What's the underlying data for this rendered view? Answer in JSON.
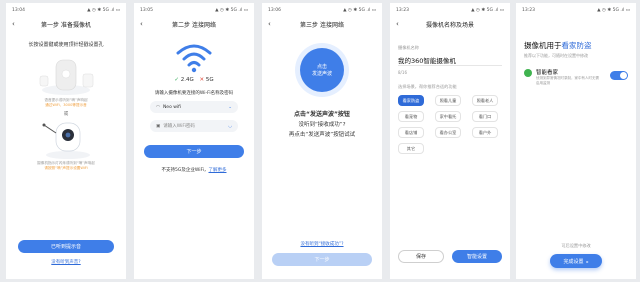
{
  "screens": [
    {
      "status": {
        "time": "13:04",
        "icons": "▲ ◷ ✱ 5G .ıl ▭"
      },
      "title": "第一步 准备摄像机",
      "instruction": "长按设置键或使用顶针轻戳设置孔",
      "device1_caption_line1": "语音提示或听到“嘀”声响起",
      "device1_caption_line2": "通过WiFi、3000等提示音",
      "or_label": "或",
      "device2_caption_line1": "摄像机指示灯闪烁或听到“嘀”声响起",
      "device2_caption_line2": "请按照“嘀”声提示设置WiFi",
      "primary_button": "已听到提示音",
      "link": "没有听到声音?"
    },
    {
      "status": {
        "time": "13:05",
        "icons": "▲ ◷ ✱ 5G .ıl ▭"
      },
      "title": "第二步 连接网络",
      "band_24": "2.4G",
      "band_5": "5G",
      "instruction": "请输入摄像机要连接的Wi-Fi名称及密码",
      "wifi_name": "Neo wifi",
      "password_placeholder": "请输入WiFi密码",
      "next_button": "下一步",
      "bottom_note": "不支持5G及企业WiFi，",
      "bottom_link": "了解更多"
    },
    {
      "status": {
        "time": "13:06",
        "icons": "▲ ◷ ✱ 5G .ıl ▭"
      },
      "title": "第三步 连接网络",
      "circle_line1": "点击",
      "circle_line2": "发送声波",
      "main_text": "点击“发送声波”按钮",
      "line2": "没听到“接收成功”?",
      "line3": "再点击“发送声波”按钮试试",
      "link": "没有听到“接收成功”?",
      "next_button": "下一步"
    },
    {
      "status": {
        "time": "13:23",
        "icons": "▲ ◷ ✱ 5G .ıl ▭"
      },
      "title": "摄像机名称及场景",
      "name_label": "摄像机名称",
      "name_value": "我的360智能摄像机",
      "name_counter": "8/16",
      "scene_label": "选择场景，帮你推荐合适的功能",
      "chips": [
        "看家防盗",
        "照看儿童",
        "照看老人",
        "看宠物",
        "家中看托",
        "看门口",
        "看店铺",
        "看办公室",
        "看户外",
        "其它"
      ],
      "save_button": "保存",
      "smart_button": "智能设置"
    },
    {
      "status": {
        "time": "13:23",
        "icons": "▲ ◷ ✱ 5G .ıl ▭"
      },
      "headline_prefix": "摄像机用于",
      "headline_highlight": "看家防盗",
      "subtitle": "推荐以下功能，可随时在设置中修改",
      "feature_title": "智能看家",
      "feature_desc_line1": "侦测到异常情况时录制，家中有人时无需",
      "feature_desc_line2": "启用监测",
      "toggle_on": true,
      "note": "可后设置中修改",
      "done_button": "完成设置",
      "accent": "#2f6bd8"
    }
  ]
}
